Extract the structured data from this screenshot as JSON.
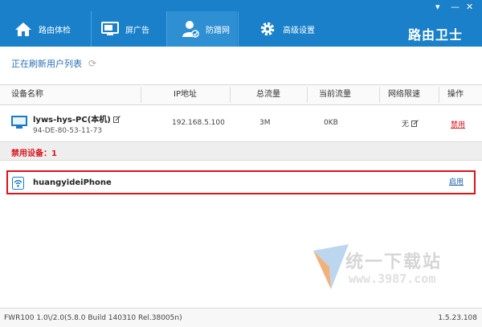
{
  "window": {
    "brand": "路由卫士",
    "ctrl_minimize": "▾",
    "ctrl_restore": "—",
    "ctrl_close": "✕"
  },
  "tabs": [
    {
      "label": "路由体检",
      "icon": "home-icon"
    },
    {
      "label": "屏广告",
      "icon": "monitor-icon"
    },
    {
      "label": "防蹭网",
      "icon": "user-shield-icon",
      "active": true
    },
    {
      "label": "高级设置",
      "icon": "gear-icon"
    }
  ],
  "subheader": {
    "text": "正在刷新用户列表",
    "icon": "refresh-icon"
  },
  "columns": [
    "设备名称",
    "IP地址",
    "总流量",
    "当前流量",
    "网络限速",
    "操作"
  ],
  "device": {
    "name": "lyws-hys-PC(本机)",
    "mac": "94-DE-80-53-11-73",
    "ip": "192.168.5.100",
    "total": "3M",
    "current": "0KB",
    "limit": "无",
    "action": "禁用"
  },
  "banned": {
    "label": "禁用设备：1",
    "items": [
      {
        "name": "huangyideiPhone",
        "action": "启用"
      }
    ]
  },
  "watermark": {
    "line1": "统一下载站",
    "line2": "www.3987.com"
  },
  "status": {
    "left": "FWR100 1.0\\/2.0(5.8.0 Build 140310 Rel.38005n)",
    "right": "1.5.23.108"
  },
  "colors": {
    "accent": "#1a80c9",
    "danger": "#d9141a",
    "link": "#1a5fb0"
  }
}
